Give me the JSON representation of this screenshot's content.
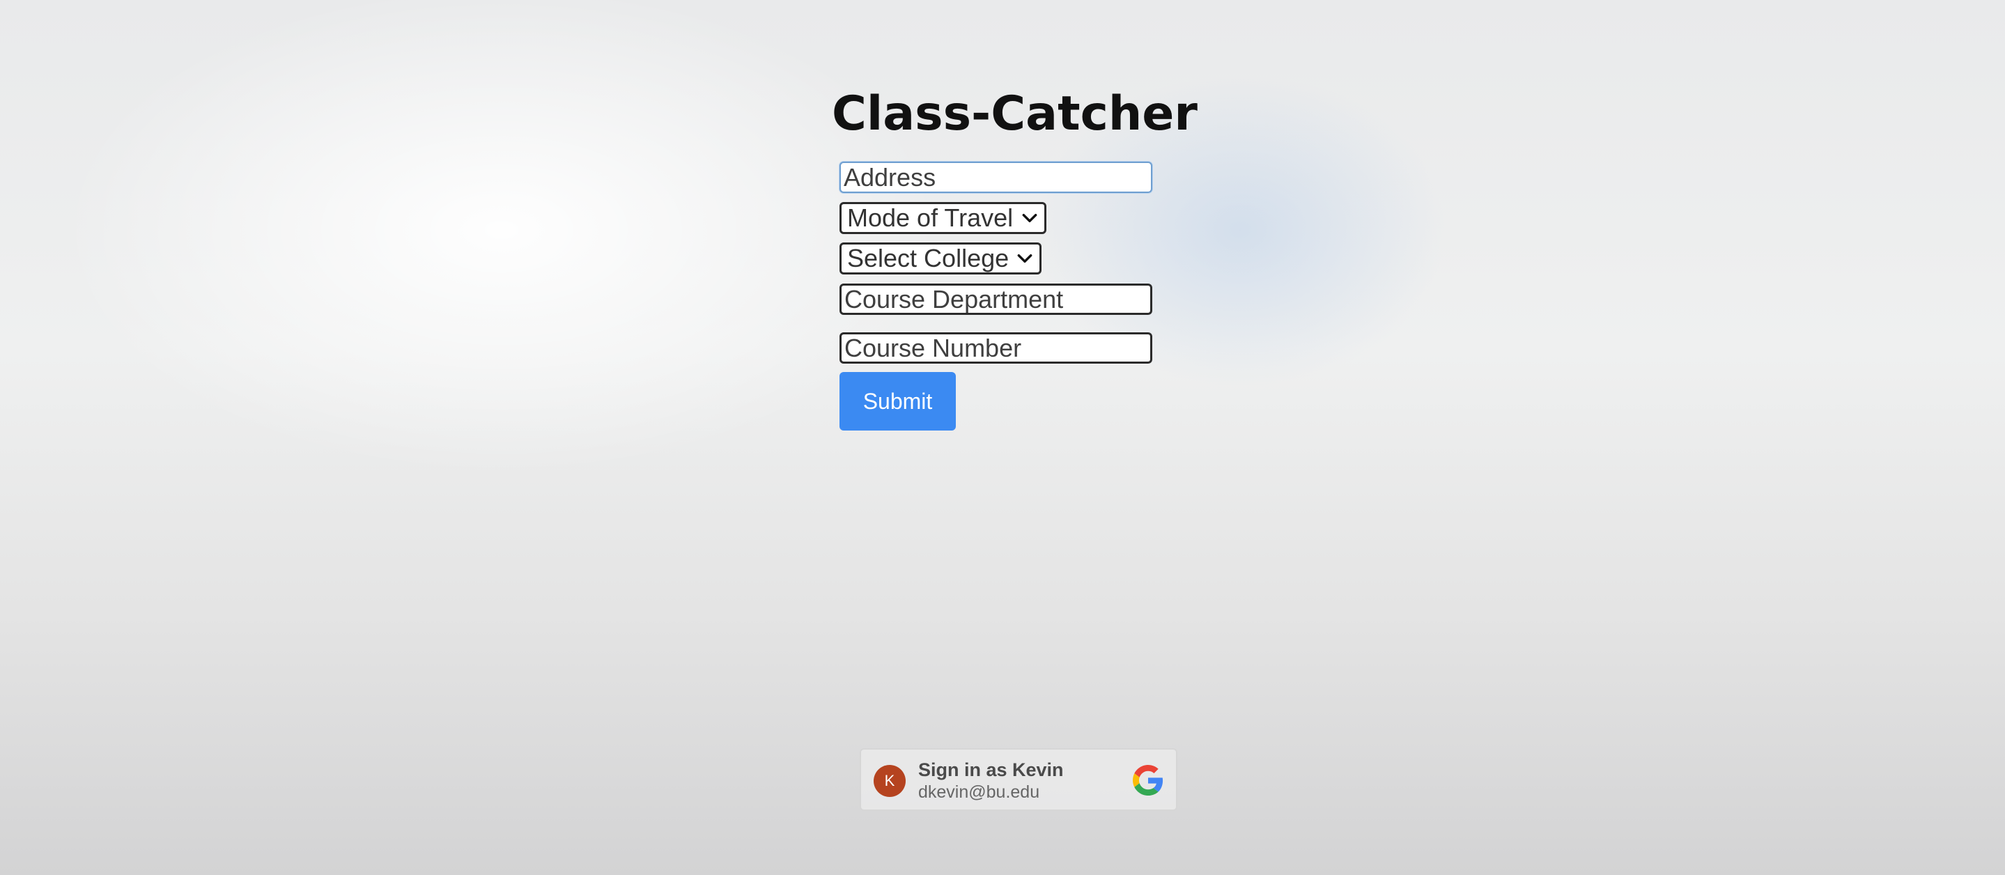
{
  "page": {
    "title": "Class-Catcher"
  },
  "form": {
    "address_placeholder": "Address",
    "travel_select_value": "Mode of Travel",
    "college_select_value": "Select College",
    "department_placeholder": "Course Department",
    "number_placeholder": "Course Number",
    "submit_label": "Submit"
  },
  "google_signin": {
    "avatar_initial": "K",
    "title": "Sign in as Kevin",
    "email": "dkevin@bu.edu",
    "logo_icon": "google-g-icon"
  },
  "colors": {
    "submit_bg": "#3b8af2",
    "avatar_bg": "#b5431f",
    "focus_border": "#6f9fd0"
  }
}
